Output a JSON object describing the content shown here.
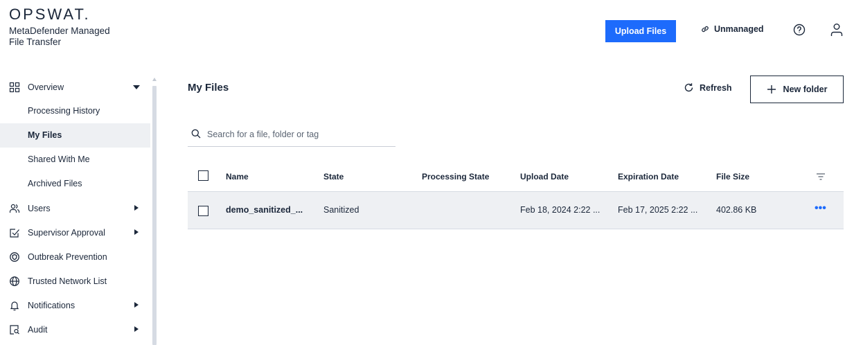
{
  "brand": {
    "logo": "OPSWAT.",
    "product_line1": "MetaDefender Managed",
    "product_line2": "File Transfer"
  },
  "header": {
    "upload_label": "Upload Files",
    "unmanaged_label": "Unmanaged",
    "icons": [
      "link-icon",
      "help-icon",
      "user-icon"
    ]
  },
  "sidebar": {
    "overview": "Overview",
    "sub_items": [
      "Processing History",
      "My Files",
      "Shared With Me",
      "Archived Files"
    ],
    "active_sub_item": "My Files",
    "items": [
      {
        "label": "Users",
        "icon": "users-icon",
        "has_arrow": true
      },
      {
        "label": "Supervisor Approval",
        "icon": "approval-icon",
        "has_arrow": true
      },
      {
        "label": "Outbreak Prevention",
        "icon": "shield-icon",
        "has_arrow": false
      },
      {
        "label": "Trusted Network List",
        "icon": "globe-icon",
        "has_arrow": false
      },
      {
        "label": "Notifications",
        "icon": "bell-icon",
        "has_arrow": true
      },
      {
        "label": "Audit",
        "icon": "audit-icon",
        "has_arrow": true
      }
    ]
  },
  "main": {
    "title": "My Files",
    "refresh_label": "Refresh",
    "new_folder_label": "New folder",
    "search_placeholder": "Search for a file, folder or tag",
    "columns": {
      "name": "Name",
      "state": "State",
      "processing_state": "Processing State",
      "upload_date": "Upload Date",
      "expiration_date": "Expiration Date",
      "file_size": "File Size"
    },
    "rows": [
      {
        "name": "demo_sanitized_...",
        "state": "Sanitized",
        "processing_state": "",
        "upload_date": "Feb 18, 2024 2:22 ...",
        "expiration_date": "Feb 17, 2025 2:22 ...",
        "file_size": "402.86 KB",
        "actions": "•••"
      }
    ]
  },
  "colors": {
    "accent": "#1d6bfc",
    "text": "#1b273a",
    "row_highlight": "#eef0f3",
    "divider": "#d6dbe3"
  }
}
